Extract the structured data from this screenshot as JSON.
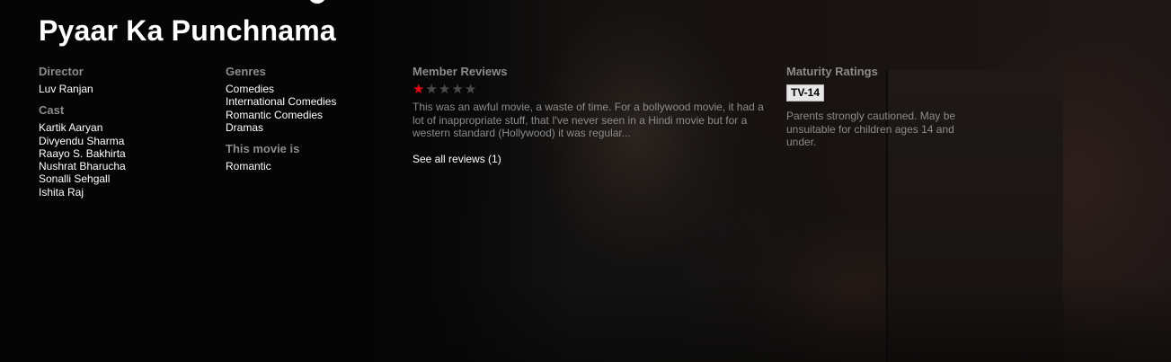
{
  "title": "Pyaar Ka Punchnama",
  "director": {
    "label": "Director",
    "names": [
      "Luv Ranjan"
    ]
  },
  "cast": {
    "label": "Cast",
    "names": [
      "Kartik Aaryan",
      "Divyendu Sharma",
      "Raayo S. Bakhirta",
      "Nushrat Bharucha",
      "Sonalli Sehgall",
      "Ishita Raj"
    ]
  },
  "genres": {
    "label": "Genres",
    "items": [
      "Comedies",
      "International Comedies",
      "Romantic Comedies",
      "Dramas"
    ]
  },
  "this_movie_is": {
    "label": "This movie is",
    "items": [
      "Romantic"
    ]
  },
  "reviews": {
    "label": "Member Reviews",
    "rating": 1,
    "max_rating": 5,
    "star_filled_color": "#e50914",
    "star_empty_color": "#4a4a4a",
    "text": "This was an awful movie, a waste of time. For a bollywood movie, it had a lot of inappropriate stuff, that I've never seen in a Hindi movie but for a western standard (Hollywood) it was regular...",
    "see_all": "See all reviews (1)"
  },
  "maturity": {
    "label": "Maturity Ratings",
    "rating": "TV-14",
    "description": "Parents strongly cautioned. May be unsuitable for children ages 14 and under."
  }
}
